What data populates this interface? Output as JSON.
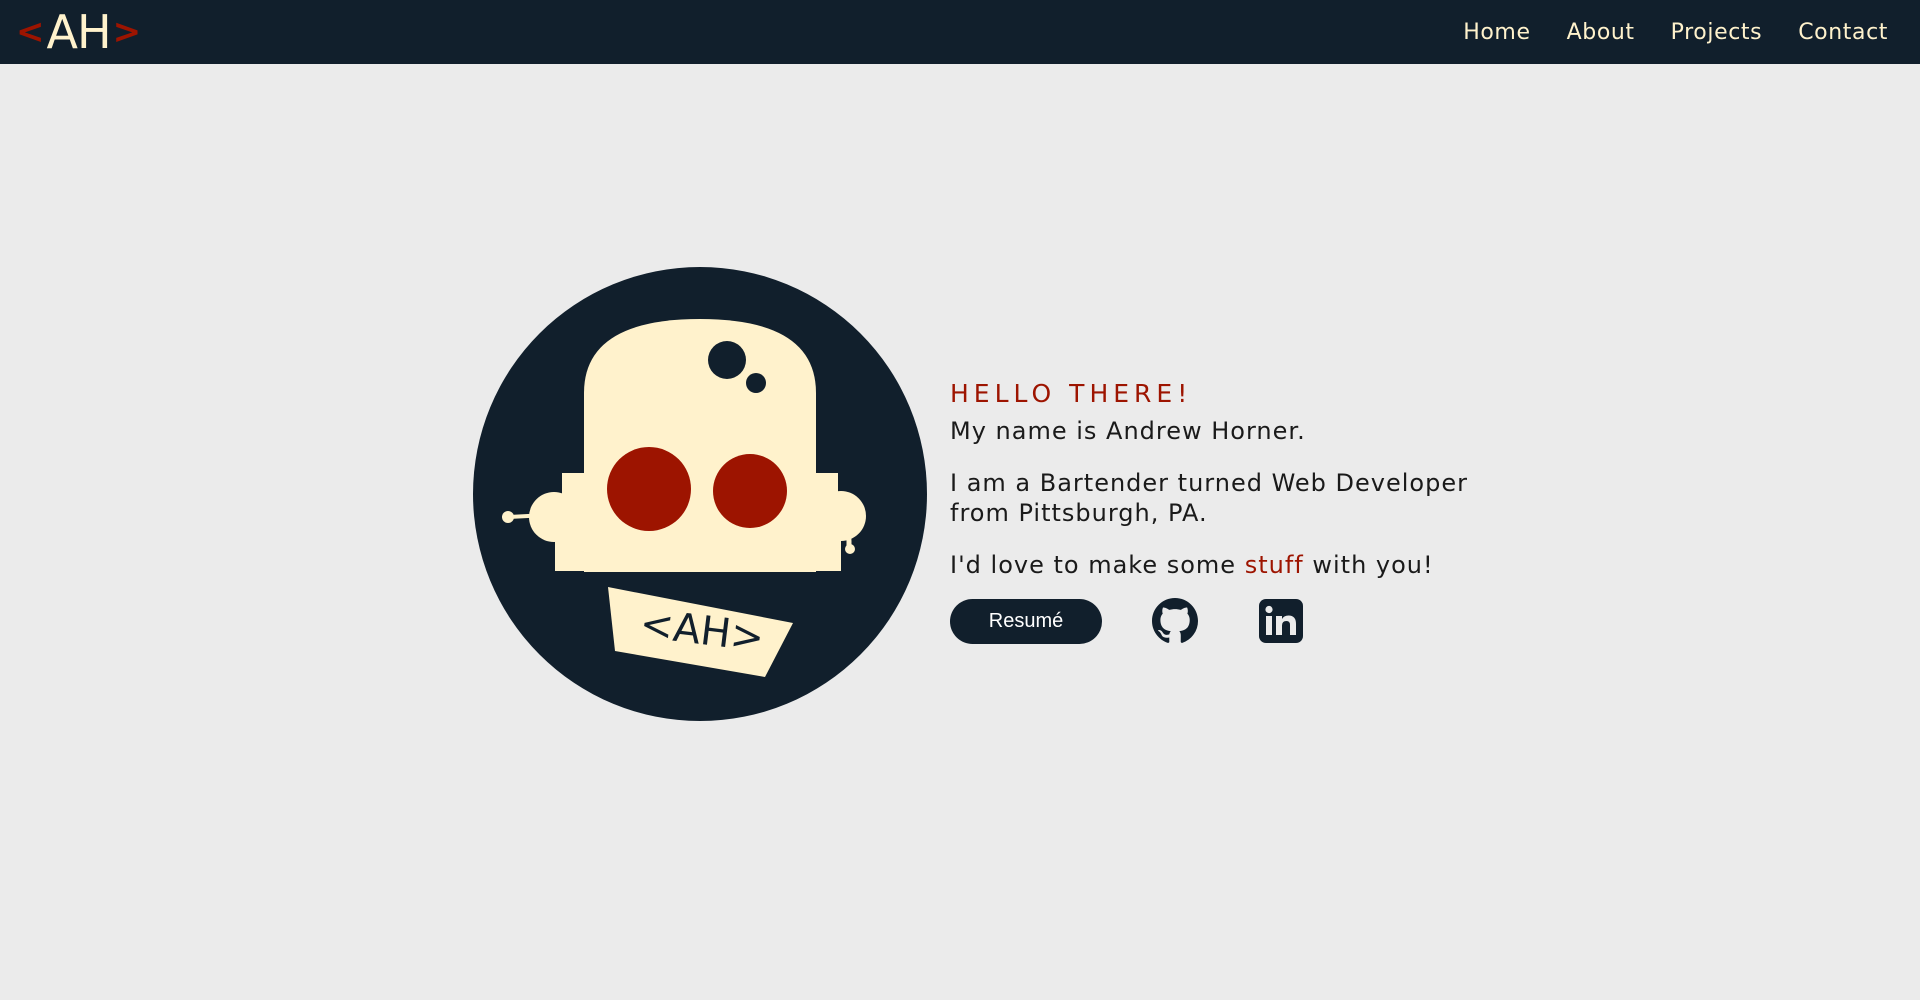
{
  "header": {
    "logo": {
      "open_bracket": "<",
      "letters": "AH",
      "close_bracket": ">"
    },
    "nav": [
      {
        "label": "Home"
      },
      {
        "label": "About"
      },
      {
        "label": "Projects"
      },
      {
        "label": "Contact"
      }
    ]
  },
  "hero": {
    "avatar_badge_text": "<AH>",
    "greeting": "HELLO THERE!",
    "name_line": "My name is Andrew Horner.",
    "bio_line": "I am a Bartender turned Web Developer from Pittsburgh, PA.",
    "cta_before": "I'd love to make some ",
    "cta_highlight": "stuff",
    "cta_after": " with you!",
    "resume_label": "Resumé",
    "icons": {
      "github": "github-icon",
      "linkedin": "linkedin-icon"
    }
  },
  "colors": {
    "navy": "#111f2c",
    "cream": "#fff2cc",
    "accent_red": "#9d1400",
    "background": "#ebebeb"
  }
}
